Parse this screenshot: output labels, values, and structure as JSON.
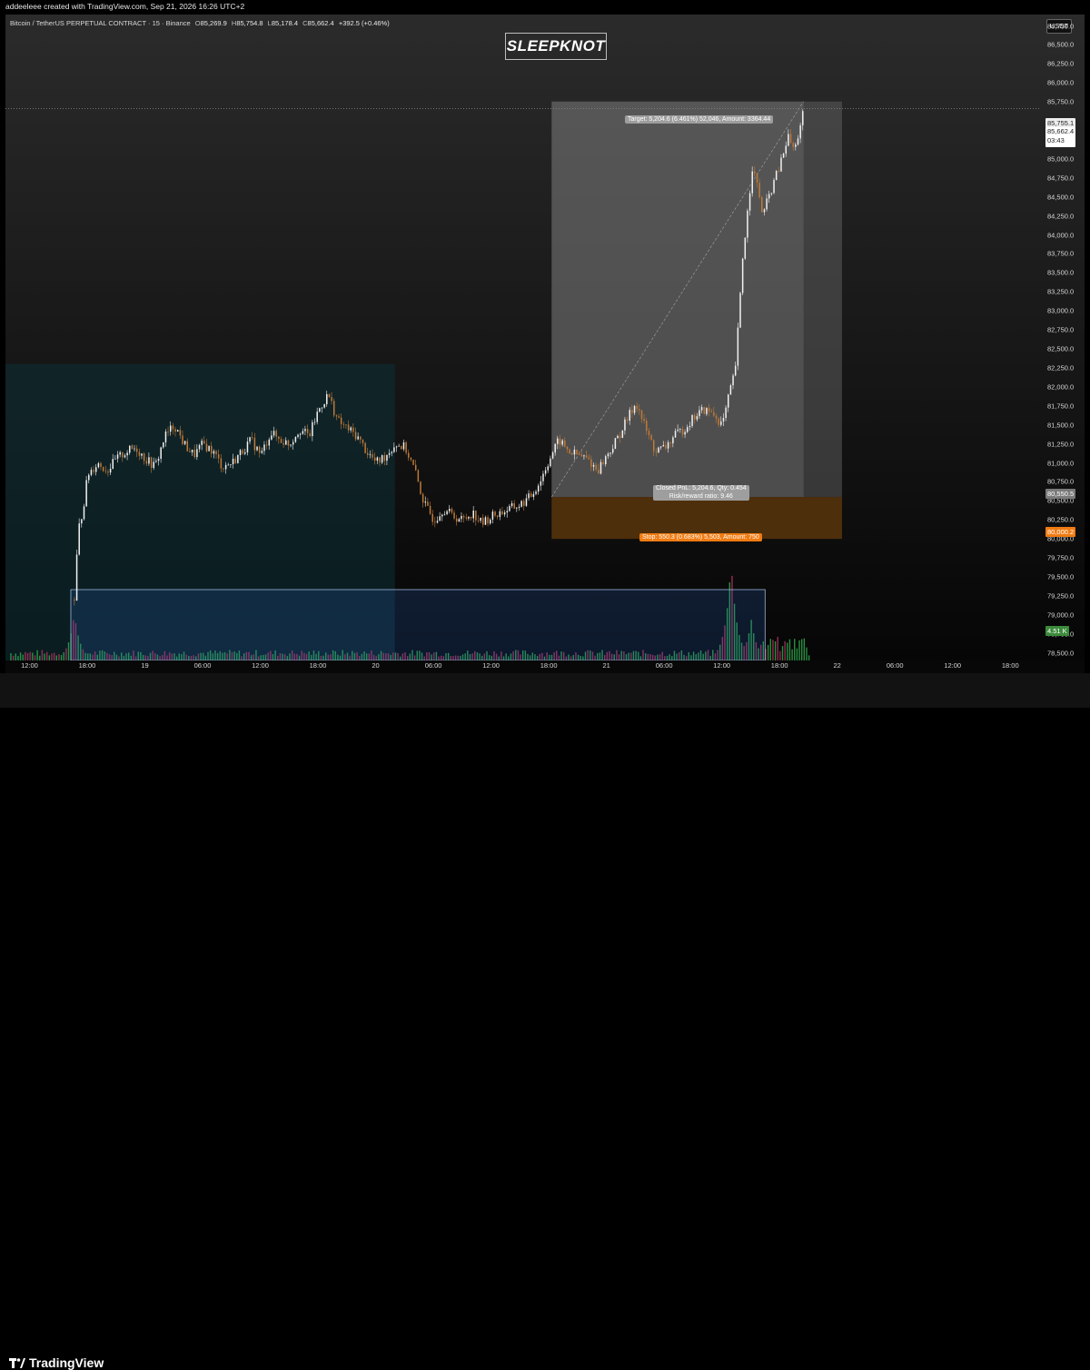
{
  "header": {
    "creator": "addeeleee created with TradingView.com, Sep 21, 2026 16:26 UTC+2"
  },
  "symbol": {
    "name": "Bitcoin / TetherUS PERPETUAL CONTRACT · 15 · Binance",
    "o_key": "O",
    "o": "85,269.9",
    "h_key": "H",
    "h": "85,754.8",
    "l_key": "L",
    "l": "85,178.4",
    "c_key": "C",
    "c": "85,662.4",
    "change": "+392.5 (+0.46%)"
  },
  "watermark": "SLEEPKNOT",
  "currency_button": "USDT",
  "position": {
    "target_label": "Target: 5,204.6 (6.461%) 52,046, Amount: 3364.44",
    "pnl_label": "Closed PnL: 5,204.6, Qty: 0.454",
    "rr_label": "Risk/reward ratio: 9.46",
    "stop_label": "Stop: 550.3 (0.683%) 5,503, Amount: 750"
  },
  "badges": {
    "last_price": "85,755.1",
    "close_price": "85,662.4",
    "countdown": "03:43",
    "entry_price": "80,550.5",
    "stop_price": "80,000.2",
    "volume": "4.51 K"
  },
  "colors": {
    "up": "#f2f2f2",
    "down": "#c07a38",
    "vol_up": "#2e9e48",
    "vol_down": "#a8305a",
    "target_zone": "#6a6a6a",
    "stop_zone": "#4e2f0c",
    "range_box": "#2c6fd6",
    "session_box": "#0c2f37"
  },
  "chart_data": {
    "type": "candlestick",
    "title": "",
    "ylim": [
      78400,
      86900
    ],
    "y_ticks": [
      "86,750.0",
      "86,500.0",
      "86,250.0",
      "86,000.0",
      "85,750.0",
      "85,500.0",
      "85,250.0",
      "85,000.0",
      "84,750.0",
      "84,500.0",
      "84,250.0",
      "84,000.0",
      "83,750.0",
      "83,500.0",
      "83,250.0",
      "83,000.0",
      "82,750.0",
      "82,500.0",
      "82,250.0",
      "82,000.0",
      "81,750.0",
      "81,500.0",
      "81,250.0",
      "81,000.0",
      "80,750.0",
      "80,500.0",
      "80,250.0",
      "80,000.0",
      "79,750.0",
      "79,500.0",
      "79,250.0",
      "79,000.0",
      "78,750.0",
      "78,500.0"
    ],
    "x_ticks": [
      "12:00",
      "18:00",
      "19",
      "06:00",
      "12:00",
      "18:00",
      "20",
      "06:00",
      "12:00",
      "18:00",
      "21",
      "06:00",
      "12:00",
      "18:00",
      "22",
      "06:00",
      "12:00",
      "18:00"
    ],
    "x_tick_hours": [
      12,
      18,
      24,
      30,
      36,
      42,
      48,
      54,
      60,
      66,
      72,
      78,
      84,
      90,
      96,
      102,
      108,
      114
    ],
    "xlim_hours": [
      9.5,
      117
    ],
    "price_path": [
      [
        16.6,
        79200
      ],
      [
        17.0,
        80100
      ],
      [
        17.5,
        80400
      ],
      [
        18.0,
        80850
      ],
      [
        19.0,
        81000
      ],
      [
        20.0,
        80900
      ],
      [
        21.0,
        81050
      ],
      [
        22.0,
        81150
      ],
      [
        23.0,
        81200
      ],
      [
        24.0,
        81050
      ],
      [
        25.0,
        80950
      ],
      [
        26.0,
        81350
      ],
      [
        27.0,
        81500
      ],
      [
        28.0,
        81250
      ],
      [
        29.0,
        81100
      ],
      [
        30.0,
        81250
      ],
      [
        31.0,
        81150
      ],
      [
        32.0,
        80950
      ],
      [
        33.0,
        81000
      ],
      [
        34.0,
        81150
      ],
      [
        35.0,
        81300
      ],
      [
        36.0,
        81100
      ],
      [
        37.0,
        81400
      ],
      [
        38.0,
        81300
      ],
      [
        39.0,
        81250
      ],
      [
        40.0,
        81450
      ],
      [
        41.0,
        81350
      ],
      [
        42.0,
        81700
      ],
      [
        43.0,
        81900
      ],
      [
        44.0,
        81550
      ],
      [
        45.0,
        81450
      ],
      [
        46.0,
        81350
      ],
      [
        47.0,
        81150
      ],
      [
        48.0,
        81000
      ],
      [
        49.0,
        81100
      ],
      [
        50.0,
        81250
      ],
      [
        51.0,
        81200
      ],
      [
        52.0,
        80900
      ],
      [
        53.0,
        80450
      ],
      [
        54.0,
        80250
      ],
      [
        55.0,
        80400
      ],
      [
        56.0,
        80300
      ],
      [
        57.0,
        80250
      ],
      [
        58.0,
        80350
      ],
      [
        59.0,
        80200
      ],
      [
        60.0,
        80300
      ],
      [
        61.0,
        80350
      ],
      [
        62.0,
        80400
      ],
      [
        63.0,
        80450
      ],
      [
        64.0,
        80550
      ],
      [
        65.0,
        80750
      ],
      [
        66.0,
        81050
      ],
      [
        67.0,
        81300
      ],
      [
        68.0,
        81150
      ],
      [
        69.0,
        81100
      ],
      [
        70.0,
        81050
      ],
      [
        71.0,
        80900
      ],
      [
        72.0,
        81100
      ],
      [
        73.0,
        81300
      ],
      [
        74.0,
        81550
      ],
      [
        75.0,
        81800
      ],
      [
        76.0,
        81450
      ],
      [
        77.0,
        81150
      ],
      [
        78.0,
        81200
      ],
      [
        79.0,
        81350
      ],
      [
        80.0,
        81450
      ],
      [
        81.0,
        81600
      ],
      [
        82.0,
        81700
      ],
      [
        83.0,
        81650
      ],
      [
        84.0,
        81500
      ],
      [
        84.7,
        81900
      ],
      [
        85.3,
        82200
      ],
      [
        85.7,
        82900
      ],
      [
        86.1,
        83700
      ],
      [
        86.6,
        84300
      ],
      [
        87.1,
        84900
      ],
      [
        87.7,
        84600
      ],
      [
        88.2,
        84250
      ],
      [
        88.8,
        84500
      ],
      [
        89.5,
        84750
      ],
      [
        90.2,
        85000
      ],
      [
        90.8,
        85300
      ],
      [
        91.5,
        85100
      ],
      [
        92.0,
        85400
      ],
      [
        92.5,
        85662
      ]
    ],
    "volume_spikes": [
      [
        16.6,
        4.2
      ],
      [
        84.9,
        8.8
      ],
      [
        87.0,
        3.6
      ],
      [
        90.6,
        2.0
      ],
      [
        92.0,
        1.6
      ]
    ],
    "position_tool": {
      "entry_price": 80550.5,
      "target_price": 85755.1,
      "stop_price": 80000.2,
      "start_hour": 66.3,
      "end_hour": 96.5,
      "exit_hour": 92.5
    },
    "range_box": {
      "start_hour": 16.3,
      "end_hour": 88.5
    },
    "session_box": {
      "start_hour": 9.5,
      "end_hour": 50.0,
      "top_price": 82300
    }
  }
}
